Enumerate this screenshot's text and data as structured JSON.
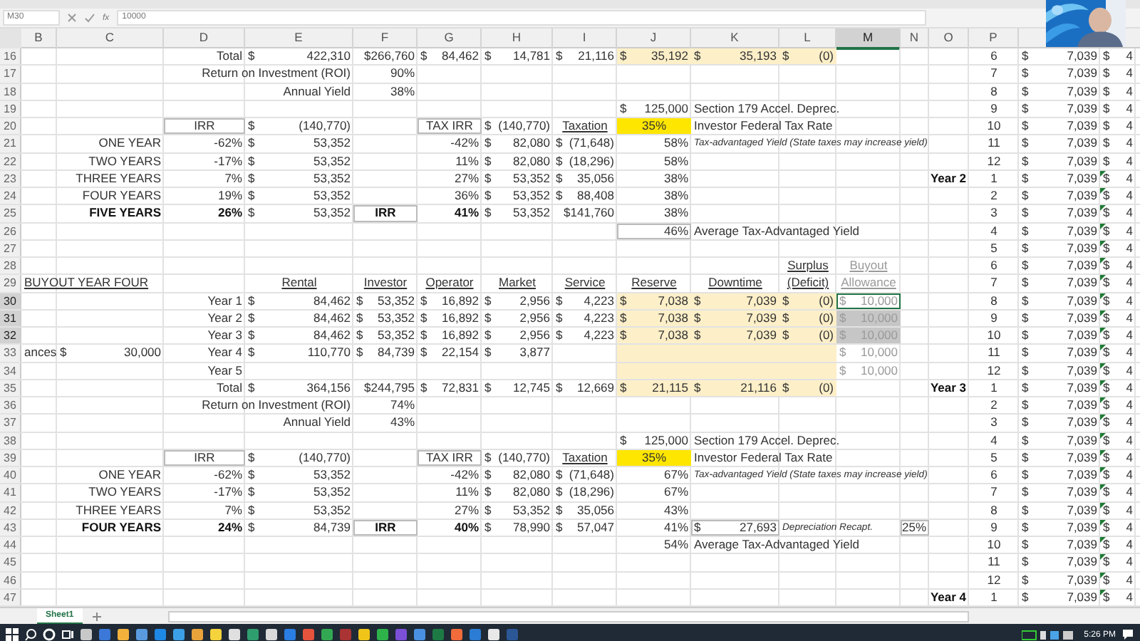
{
  "name_box": "M30",
  "function_label": "fx",
  "formula": "10000",
  "columns": [
    {
      "label": "B",
      "selected": false
    },
    {
      "label": "C",
      "selected": false
    },
    {
      "label": "D",
      "selected": false
    },
    {
      "label": "E",
      "selected": false
    },
    {
      "label": "F",
      "selected": false
    },
    {
      "label": "G",
      "selected": false
    },
    {
      "label": "H",
      "selected": false
    },
    {
      "label": "I",
      "selected": false
    },
    {
      "label": "J",
      "selected": false
    },
    {
      "label": "K",
      "selected": false
    },
    {
      "label": "L",
      "selected": false
    },
    {
      "label": "M",
      "selected": true
    },
    {
      "label": "N",
      "selected": false
    },
    {
      "label": "O",
      "selected": false
    },
    {
      "label": "P",
      "selected": false
    }
  ],
  "rows": [
    {
      "num": "16",
      "selected": false,
      "cells": {
        "D": {
          "text": "Total"
        },
        "E": {
          "prefix": "$",
          "text": "422,310"
        },
        "F": {
          "text": "$266,760"
        },
        "G": {
          "prefix": "$",
          "text": "84,462"
        },
        "H": {
          "prefix": "$",
          "text": "14,781"
        },
        "I": {
          "prefix": "$",
          "text": "21,116"
        },
        "J": {
          "prefix": "$",
          "text": "35,192",
          "shaded": true
        },
        "K": {
          "prefix": "$",
          "text": "35,193",
          "shaded": true
        },
        "L": {
          "prefix": "$",
          "text": "(0)",
          "shaded": true
        },
        "P": {
          "text": "6",
          "centered": true
        },
        "Q": {
          "prefix": "$",
          "text": "7,039"
        },
        "R": {
          "prefix": "$",
          "text": "4"
        }
      }
    },
    {
      "num": "17",
      "selected": false,
      "cells": {
        "E": {
          "text": "Return on Investment (ROI)"
        },
        "F": {
          "text": "90%"
        },
        "P": {
          "text": "7",
          "centered": true
        },
        "Q": {
          "prefix": "$",
          "text": "7,039"
        },
        "R": {
          "prefix": "$",
          "text": "4"
        }
      }
    },
    {
      "num": "18",
      "selected": false,
      "cells": {
        "E": {
          "text": "Annual Yield"
        },
        "F": {
          "text": "38%"
        },
        "P": {
          "text": "8",
          "centered": true
        },
        "Q": {
          "prefix": "$",
          "text": "7,039"
        },
        "R": {
          "prefix": "$",
          "text": "4"
        }
      }
    },
    {
      "num": "19",
      "selected": false,
      "cells": {
        "J": {
          "prefix": "$",
          "text": "125,000"
        },
        "K": {
          "text": "Section 179 Accel. Deprec.",
          "left_aligned": true
        },
        "P": {
          "text": "9",
          "centered": true
        },
        "Q": {
          "prefix": "$",
          "text": "7,039"
        },
        "R": {
          "prefix": "$",
          "text": "4"
        }
      }
    },
    {
      "num": "20",
      "selected": false,
      "cells": {
        "D": {
          "text": "IRR",
          "centered": true,
          "boxed": true
        },
        "E": {
          "prefix": "$",
          "text": "(140,770)"
        },
        "G": {
          "text": "TAX IRR",
          "centered": true,
          "boxed": true
        },
        "H": {
          "prefix": "$",
          "text": "(140,770)"
        },
        "I": {
          "text": "Taxation",
          "centered": true,
          "underline": true
        },
        "J": {
          "text": "35%",
          "centered": true,
          "highlighted": true
        },
        "K": {
          "text": "Investor Federal Tax Rate",
          "left_aligned": true
        },
        "P": {
          "text": "10",
          "centered": true
        },
        "Q": {
          "prefix": "$",
          "text": "7,039"
        },
        "R": {
          "prefix": "$",
          "text": "4"
        }
      }
    },
    {
      "num": "21",
      "selected": false,
      "cells": {
        "C": {
          "text": "ONE YEAR"
        },
        "D": {
          "text": "-62%"
        },
        "E": {
          "prefix": "$",
          "text": "53,352"
        },
        "G": {
          "text": "-42%"
        },
        "H": {
          "prefix": "$",
          "text": "82,080"
        },
        "I": {
          "prefix": "$",
          "text": "(71,648)"
        },
        "J": {
          "text": "58%"
        },
        "K": {
          "text": "Tax-advantaged Yield (State taxes may increase yield)",
          "left_aligned": true,
          "italic": true
        },
        "P": {
          "text": "11",
          "centered": true
        },
        "Q": {
          "prefix": "$",
          "text": "7,039"
        },
        "R": {
          "prefix": "$",
          "text": "4"
        }
      }
    },
    {
      "num": "22",
      "selected": false,
      "cells": {
        "C": {
          "text": "TWO YEARS"
        },
        "D": {
          "text": "-17%"
        },
        "E": {
          "prefix": "$",
          "text": "53,352"
        },
        "G": {
          "text": "11%"
        },
        "H": {
          "prefix": "$",
          "text": "82,080"
        },
        "I": {
          "prefix": "$",
          "text": "(18,296)"
        },
        "J": {
          "text": "58%"
        },
        "P": {
          "text": "12",
          "centered": true
        },
        "Q": {
          "prefix": "$",
          "text": "7,039"
        },
        "R": {
          "prefix": "$",
          "text": "4"
        }
      }
    },
    {
      "num": "23",
      "selected": false,
      "cells": {
        "C": {
          "text": "THREE YEARS"
        },
        "D": {
          "text": "7%"
        },
        "E": {
          "prefix": "$",
          "text": "53,352"
        },
        "G": {
          "text": "27%"
        },
        "H": {
          "prefix": "$",
          "text": "53,352"
        },
        "I": {
          "prefix": "$",
          "text": "35,056"
        },
        "J": {
          "text": "38%"
        },
        "O": {
          "text": "Year 2",
          "bold": true
        },
        "P": {
          "text": "1",
          "centered": true
        },
        "Q": {
          "prefix": "$",
          "text": "7,039"
        },
        "R": {
          "prefix": "$",
          "text": "4",
          "flag": true
        }
      }
    },
    {
      "num": "24",
      "selected": false,
      "cells": {
        "C": {
          "text": "FOUR YEARS"
        },
        "D": {
          "text": "19%"
        },
        "E": {
          "prefix": "$",
          "text": "53,352"
        },
        "G": {
          "text": "36%"
        },
        "H": {
          "prefix": "$",
          "text": "53,352"
        },
        "I": {
          "prefix": "$",
          "text": "88,408"
        },
        "J": {
          "text": "38%"
        },
        "P": {
          "text": "2",
          "centered": true
        },
        "Q": {
          "prefix": "$",
          "text": "7,039"
        },
        "R": {
          "prefix": "$",
          "text": "4",
          "flag": true
        }
      }
    },
    {
      "num": "25",
      "selected": false,
      "cells": {
        "C": {
          "text": "FIVE YEARS",
          "bold": true
        },
        "D": {
          "text": "26%",
          "bold": true
        },
        "E": {
          "prefix": "$",
          "text": "53,352"
        },
        "F": {
          "text": "IRR",
          "centered": true,
          "bold": true,
          "boxed": true
        },
        "G": {
          "text": "41%",
          "bold": true
        },
        "H": {
          "prefix": "$",
          "text": "53,352"
        },
        "I": {
          "text": "$141,760"
        },
        "J": {
          "text": "38%"
        },
        "P": {
          "text": "3",
          "centered": true
        },
        "Q": {
          "prefix": "$",
          "text": "7,039"
        },
        "R": {
          "prefix": "$",
          "text": "4",
          "flag": true
        }
      }
    },
    {
      "num": "26",
      "selected": false,
      "cells": {
        "J": {
          "text": "46%",
          "boxed": true
        },
        "K": {
          "text": "Average Tax-Advantaged Yield",
          "left_aligned": true
        },
        "P": {
          "text": "4",
          "centered": true
        },
        "Q": {
          "prefix": "$",
          "text": "7,039"
        },
        "R": {
          "prefix": "$",
          "text": "4",
          "flag": true
        }
      }
    },
    {
      "num": "27",
      "selected": false,
      "cells": {
        "P": {
          "text": "5",
          "centered": true
        },
        "Q": {
          "prefix": "$",
          "text": "7,039"
        },
        "R": {
          "prefix": "$",
          "text": "4",
          "flag": true
        }
      }
    },
    {
      "num": "28",
      "selected": false,
      "cells": {
        "L": {
          "text": "Surplus",
          "centered": true,
          "underline": true
        },
        "M": {
          "text": "Buyout",
          "centered": true,
          "underline": true,
          "muted": true
        },
        "P": {
          "text": "6",
          "centered": true
        },
        "Q": {
          "prefix": "$",
          "text": "7,039"
        },
        "R": {
          "prefix": "$",
          "text": "4",
          "flag": true
        }
      }
    },
    {
      "num": "29",
      "selected": false,
      "cells": {
        "B": {
          "text": "BUYOUT YEAR FOUR",
          "left_aligned": true,
          "underline": true
        },
        "E": {
          "text": "Rental",
          "centered": true,
          "underline": true
        },
        "F": {
          "text": "Investor",
          "centered": true,
          "underline": true
        },
        "G": {
          "text": "Operator",
          "centered": true,
          "underline": true
        },
        "H": {
          "text": "Market",
          "centered": true,
          "underline": true
        },
        "I": {
          "text": "Service",
          "centered": true,
          "underline": true
        },
        "J": {
          "text": "Reserve",
          "centered": true,
          "underline": true
        },
        "K": {
          "text": "Downtime",
          "centered": true,
          "underline": true
        },
        "L": {
          "text": "(Deficit)",
          "centered": true,
          "underline": true
        },
        "M": {
          "text": "Allowance",
          "centered": true,
          "underline": true,
          "muted": true
        },
        "P": {
          "text": "7",
          "centered": true
        },
        "Q": {
          "prefix": "$",
          "text": "7,039"
        },
        "R": {
          "prefix": "$",
          "text": "4",
          "flag": true
        }
      }
    },
    {
      "num": "30",
      "selected": true,
      "cells": {
        "D": {
          "text": "Year 1"
        },
        "E": {
          "prefix": "$",
          "text": "84,462"
        },
        "F": {
          "prefix": "$",
          "text": "53,352"
        },
        "G": {
          "prefix": "$",
          "text": "16,892"
        },
        "H": {
          "prefix": "$",
          "text": "2,956"
        },
        "I": {
          "prefix": "$",
          "text": "4,223"
        },
        "J": {
          "prefix": "$",
          "text": "7,038",
          "shaded": true
        },
        "K": {
          "prefix": "$",
          "text": "7,039",
          "shaded": true
        },
        "L": {
          "prefix": "$",
          "text": "(0)",
          "shaded": true
        },
        "M": {
          "prefix": "$",
          "text": "10,000",
          "muted": true,
          "active": true
        },
        "P": {
          "text": "8",
          "centered": true
        },
        "Q": {
          "prefix": "$",
          "text": "7,039"
        },
        "R": {
          "prefix": "$",
          "text": "4",
          "flag": true
        }
      }
    },
    {
      "num": "31",
      "selected": true,
      "cells": {
        "D": {
          "text": "Year 2"
        },
        "E": {
          "prefix": "$",
          "text": "84,462"
        },
        "F": {
          "prefix": "$",
          "text": "53,352"
        },
        "G": {
          "prefix": "$",
          "text": "16,892"
        },
        "H": {
          "prefix": "$",
          "text": "2,956"
        },
        "I": {
          "prefix": "$",
          "text": "4,223"
        },
        "J": {
          "prefix": "$",
          "text": "7,038",
          "shaded": true
        },
        "K": {
          "prefix": "$",
          "text": "7,039",
          "shaded": true
        },
        "L": {
          "prefix": "$",
          "text": "(0)",
          "shaded": true
        },
        "M": {
          "prefix": "$",
          "text": "10,000",
          "muted": true,
          "in_selection": true
        },
        "P": {
          "text": "9",
          "centered": true
        },
        "Q": {
          "prefix": "$",
          "text": "7,039"
        },
        "R": {
          "prefix": "$",
          "text": "4",
          "flag": true
        }
      }
    },
    {
      "num": "32",
      "selected": true,
      "cells": {
        "D": {
          "text": "Year 3"
        },
        "E": {
          "prefix": "$",
          "text": "84,462"
        },
        "F": {
          "prefix": "$",
          "text": "53,352"
        },
        "G": {
          "prefix": "$",
          "text": "16,892"
        },
        "H": {
          "prefix": "$",
          "text": "2,956"
        },
        "I": {
          "prefix": "$",
          "text": "4,223"
        },
        "J": {
          "prefix": "$",
          "text": "7,038",
          "shaded": true
        },
        "K": {
          "prefix": "$",
          "text": "7,039",
          "shaded": true
        },
        "L": {
          "prefix": "$",
          "text": "(0)",
          "shaded": true
        },
        "M": {
          "prefix": "$",
          "text": "10,000",
          "muted": true,
          "in_selection": true
        },
        "P": {
          "text": "10",
          "centered": true
        },
        "Q": {
          "prefix": "$",
          "text": "7,039"
        },
        "R": {
          "prefix": "$",
          "text": "4",
          "flag": true
        }
      }
    },
    {
      "num": "33",
      "selected": false,
      "cells": {
        "B": {
          "text": "ances",
          "left_aligned": true
        },
        "C": {
          "prefix": "$",
          "text": "30,000"
        },
        "D": {
          "text": "Year 4"
        },
        "E": {
          "prefix": "$",
          "text": "110,770"
        },
        "F": {
          "prefix": "$",
          "text": "84,739"
        },
        "G": {
          "prefix": "$",
          "text": "22,154"
        },
        "H": {
          "prefix": "$",
          "text": "3,877"
        },
        "J": {
          "shaded": true
        },
        "K": {
          "shaded": true
        },
        "L": {
          "shaded": true
        },
        "M": {
          "prefix": "$",
          "text": "10,000",
          "muted": true
        },
        "P": {
          "text": "11",
          "centered": true
        },
        "Q": {
          "prefix": "$",
          "text": "7,039"
        },
        "R": {
          "prefix": "$",
          "text": "4",
          "flag": true
        }
      }
    },
    {
      "num": "34",
      "selected": false,
      "cells": {
        "D": {
          "text": "Year 5"
        },
        "J": {
          "shaded": true
        },
        "K": {
          "shaded": true
        },
        "L": {
          "shaded": true
        },
        "M": {
          "prefix": "$",
          "text": "10,000",
          "muted": true
        },
        "P": {
          "text": "12",
          "centered": true
        },
        "Q": {
          "prefix": "$",
          "text": "7,039"
        },
        "R": {
          "prefix": "$",
          "text": "4",
          "flag": true
        }
      }
    },
    {
      "num": "35",
      "selected": false,
      "cells": {
        "D": {
          "text": "Total"
        },
        "E": {
          "prefix": "$",
          "text": "364,156"
        },
        "F": {
          "text": "$244,795"
        },
        "G": {
          "prefix": "$",
          "text": "72,831"
        },
        "H": {
          "prefix": "$",
          "text": "12,745"
        },
        "I": {
          "prefix": "$",
          "text": "12,669"
        },
        "J": {
          "prefix": "$",
          "text": "21,115",
          "shaded": true
        },
        "K": {
          "prefix": "$",
          "text": "21,116",
          "shaded": true
        },
        "L": {
          "prefix": "$",
          "text": "(0)",
          "shaded": true
        },
        "O": {
          "text": "Year 3",
          "bold": true
        },
        "P": {
          "text": "1",
          "centered": true
        },
        "Q": {
          "prefix": "$",
          "text": "7,039"
        },
        "R": {
          "prefix": "$",
          "text": "4",
          "flag": true
        }
      }
    },
    {
      "num": "36",
      "selected": false,
      "cells": {
        "E": {
          "text": "Return on Investment (ROI)"
        },
        "F": {
          "text": "74%"
        },
        "P": {
          "text": "2",
          "centered": true
        },
        "Q": {
          "prefix": "$",
          "text": "7,039"
        },
        "R": {
          "prefix": "$",
          "text": "4",
          "flag": true
        }
      }
    },
    {
      "num": "37",
      "selected": false,
      "cells": {
        "E": {
          "text": "Annual Yield"
        },
        "F": {
          "text": "43%"
        },
        "P": {
          "text": "3",
          "centered": true
        },
        "Q": {
          "prefix": "$",
          "text": "7,039"
        },
        "R": {
          "prefix": "$",
          "text": "4",
          "flag": true
        }
      }
    },
    {
      "num": "38",
      "selected": false,
      "cells": {
        "J": {
          "prefix": "$",
          "text": "125,000"
        },
        "K": {
          "text": "Section 179 Accel. Deprec.",
          "left_aligned": true
        },
        "P": {
          "text": "4",
          "centered": true
        },
        "Q": {
          "prefix": "$",
          "text": "7,039"
        },
        "R": {
          "prefix": "$",
          "text": "4",
          "flag": true
        }
      }
    },
    {
      "num": "39",
      "selected": false,
      "cells": {
        "D": {
          "text": "IRR",
          "centered": true,
          "boxed": true
        },
        "E": {
          "prefix": "$",
          "text": "(140,770)"
        },
        "G": {
          "text": "TAX IRR",
          "centered": true,
          "boxed": true
        },
        "H": {
          "prefix": "$",
          "text": "(140,770)"
        },
        "I": {
          "text": "Taxation",
          "centered": true,
          "underline": true
        },
        "J": {
          "text": "35%",
          "centered": true,
          "highlighted": true
        },
        "K": {
          "text": "Investor Federal Tax Rate",
          "left_aligned": true
        },
        "P": {
          "text": "5",
          "centered": true
        },
        "Q": {
          "prefix": "$",
          "text": "7,039"
        },
        "R": {
          "prefix": "$",
          "text": "4",
          "flag": true
        }
      }
    },
    {
      "num": "40",
      "selected": false,
      "cells": {
        "C": {
          "text": "ONE YEAR"
        },
        "D": {
          "text": "-62%"
        },
        "E": {
          "prefix": "$",
          "text": "53,352"
        },
        "G": {
          "text": "-42%"
        },
        "H": {
          "prefix": "$",
          "text": "82,080"
        },
        "I": {
          "prefix": "$",
          "text": "(71,648)"
        },
        "J": {
          "text": "67%"
        },
        "K": {
          "text": "Tax-advantaged Yield (State taxes may increase yield)",
          "left_aligned": true,
          "italic": true
        },
        "P": {
          "text": "6",
          "centered": true
        },
        "Q": {
          "prefix": "$",
          "text": "7,039"
        },
        "R": {
          "prefix": "$",
          "text": "4",
          "flag": true
        }
      }
    },
    {
      "num": "41",
      "selected": false,
      "cells": {
        "C": {
          "text": "TWO YEARS"
        },
        "D": {
          "text": "-17%"
        },
        "E": {
          "prefix": "$",
          "text": "53,352"
        },
        "G": {
          "text": "11%"
        },
        "H": {
          "prefix": "$",
          "text": "82,080"
        },
        "I": {
          "prefix": "$",
          "text": "(18,296)"
        },
        "J": {
          "text": "67%"
        },
        "P": {
          "text": "7",
          "centered": true
        },
        "Q": {
          "prefix": "$",
          "text": "7,039"
        },
        "R": {
          "prefix": "$",
          "text": "4",
          "flag": true
        }
      }
    },
    {
      "num": "42",
      "selected": false,
      "cells": {
        "C": {
          "text": "THREE YEARS"
        },
        "D": {
          "text": "7%"
        },
        "E": {
          "prefix": "$",
          "text": "53,352"
        },
        "G": {
          "text": "27%"
        },
        "H": {
          "prefix": "$",
          "text": "53,352"
        },
        "I": {
          "prefix": "$",
          "text": "35,056"
        },
        "J": {
          "text": "43%"
        },
        "P": {
          "text": "8",
          "centered": true
        },
        "Q": {
          "prefix": "$",
          "text": "7,039"
        },
        "R": {
          "prefix": "$",
          "text": "4",
          "flag": true
        }
      }
    },
    {
      "num": "43",
      "selected": false,
      "cells": {
        "C": {
          "text": "FOUR YEARS",
          "bold": true
        },
        "D": {
          "text": "24%",
          "bold": true
        },
        "E": {
          "prefix": "$",
          "text": "84,739"
        },
        "F": {
          "text": "IRR",
          "centered": true,
          "bold": true,
          "boxed": true
        },
        "G": {
          "text": "40%",
          "bold": true
        },
        "H": {
          "prefix": "$",
          "text": "78,990"
        },
        "I": {
          "prefix": "$",
          "text": "57,047"
        },
        "J": {
          "text": "41%"
        },
        "K": {
          "prefix": "$",
          "text": "27,693",
          "boxed": true
        },
        "L": {
          "text": "Depreciation Recapt.",
          "left_aligned": true,
          "italic": true
        },
        "N": {
          "text": "25%",
          "boxed": true
        },
        "P": {
          "text": "9",
          "centered": true
        },
        "Q": {
          "prefix": "$",
          "text": "7,039"
        },
        "R": {
          "prefix": "$",
          "text": "4",
          "flag": true
        }
      }
    },
    {
      "num": "44",
      "selected": false,
      "cells": {
        "J": {
          "text": "54%"
        },
        "K": {
          "text": "Average Tax-Advantaged Yield",
          "left_aligned": true
        },
        "P": {
          "text": "10",
          "centered": true
        },
        "Q": {
          "prefix": "$",
          "text": "7,039"
        },
        "R": {
          "prefix": "$",
          "text": "4",
          "flag": true
        }
      }
    },
    {
      "num": "45",
      "selected": false,
      "cells": {
        "P": {
          "text": "11",
          "centered": true
        },
        "Q": {
          "prefix": "$",
          "text": "7,039"
        },
        "R": {
          "prefix": "$",
          "text": "4",
          "flag": true
        }
      }
    },
    {
      "num": "46",
      "selected": false,
      "cells": {
        "P": {
          "text": "12",
          "centered": true
        },
        "Q": {
          "prefix": "$",
          "text": "7,039"
        },
        "R": {
          "prefix": "$",
          "text": "4",
          "flag": true
        }
      }
    },
    {
      "num": "47",
      "selected": false,
      "cells": {
        "O": {
          "text": "Year 4",
          "bold": true
        },
        "P": {
          "text": "1",
          "centered": true
        },
        "Q": {
          "prefix": "$",
          "text": "7,039"
        },
        "R": {
          "prefix": "$",
          "text": "4",
          "flag": true
        }
      }
    }
  ],
  "sheet_tabs": [
    {
      "label": "Sheet1",
      "selected": true
    }
  ],
  "clock": "5:26 PM"
}
